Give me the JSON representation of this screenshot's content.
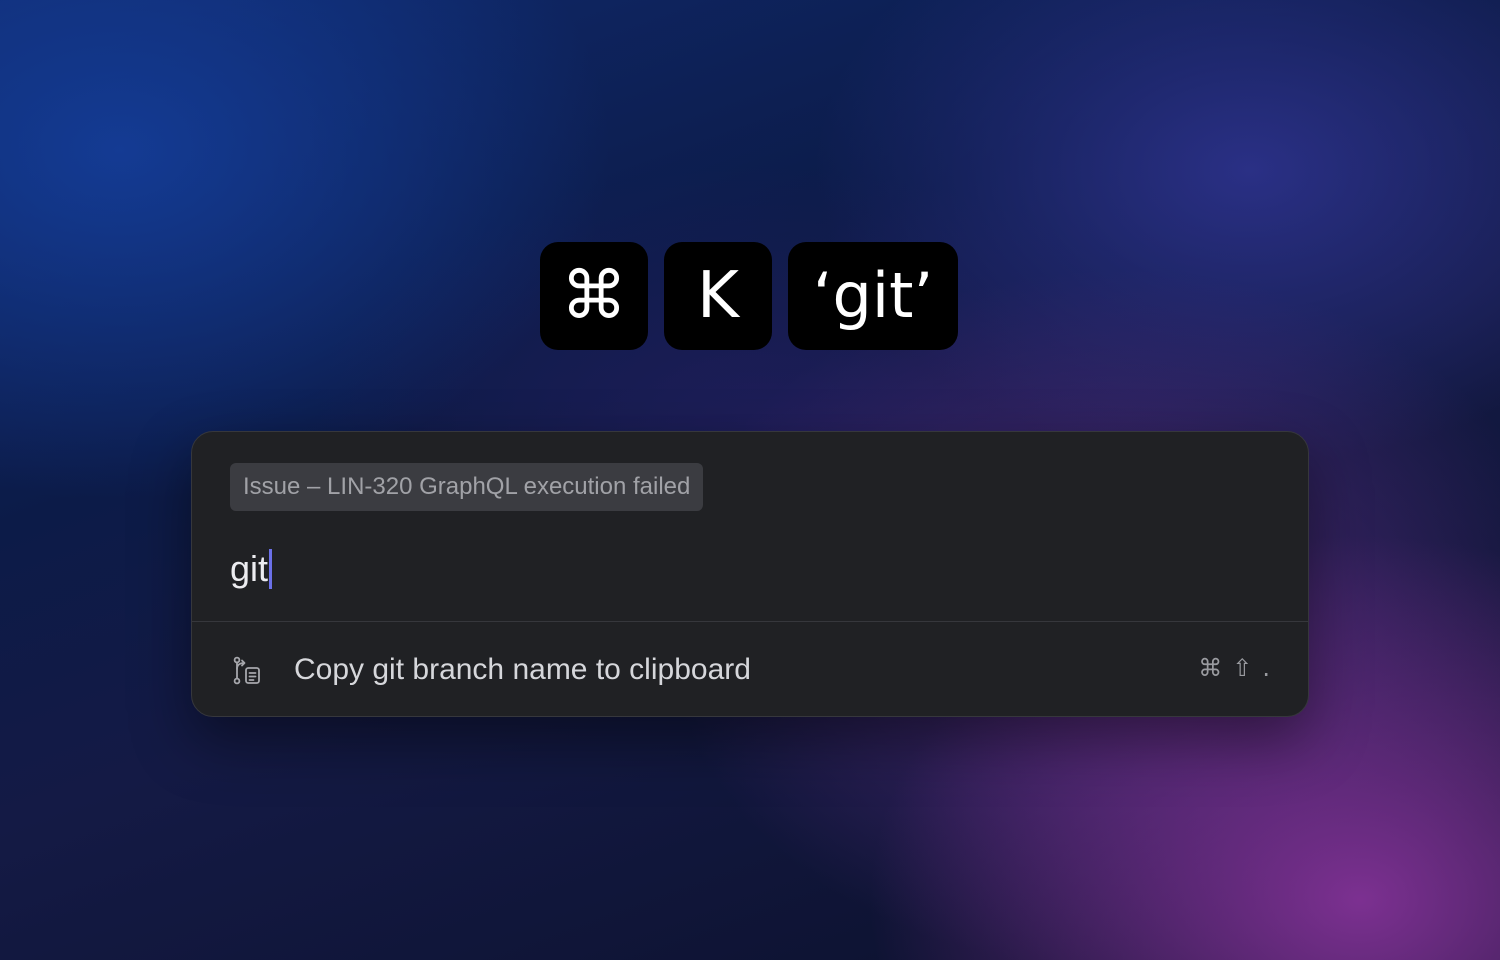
{
  "keys": {
    "cmd": "⌘",
    "k": "K",
    "query": "‘git’"
  },
  "palette": {
    "context_chip": "Issue – LIN-320 GraphQL execution failed",
    "search_value": "git",
    "results": [
      {
        "icon": "git-branch-clipboard-icon",
        "label": "Copy git branch name to clipboard",
        "shortcut": [
          "⌘",
          "⇧",
          "."
        ]
      }
    ]
  },
  "colors": {
    "caret": "#6b70e8",
    "palette_bg": "#202124",
    "chip_bg": "#3b3c41"
  }
}
